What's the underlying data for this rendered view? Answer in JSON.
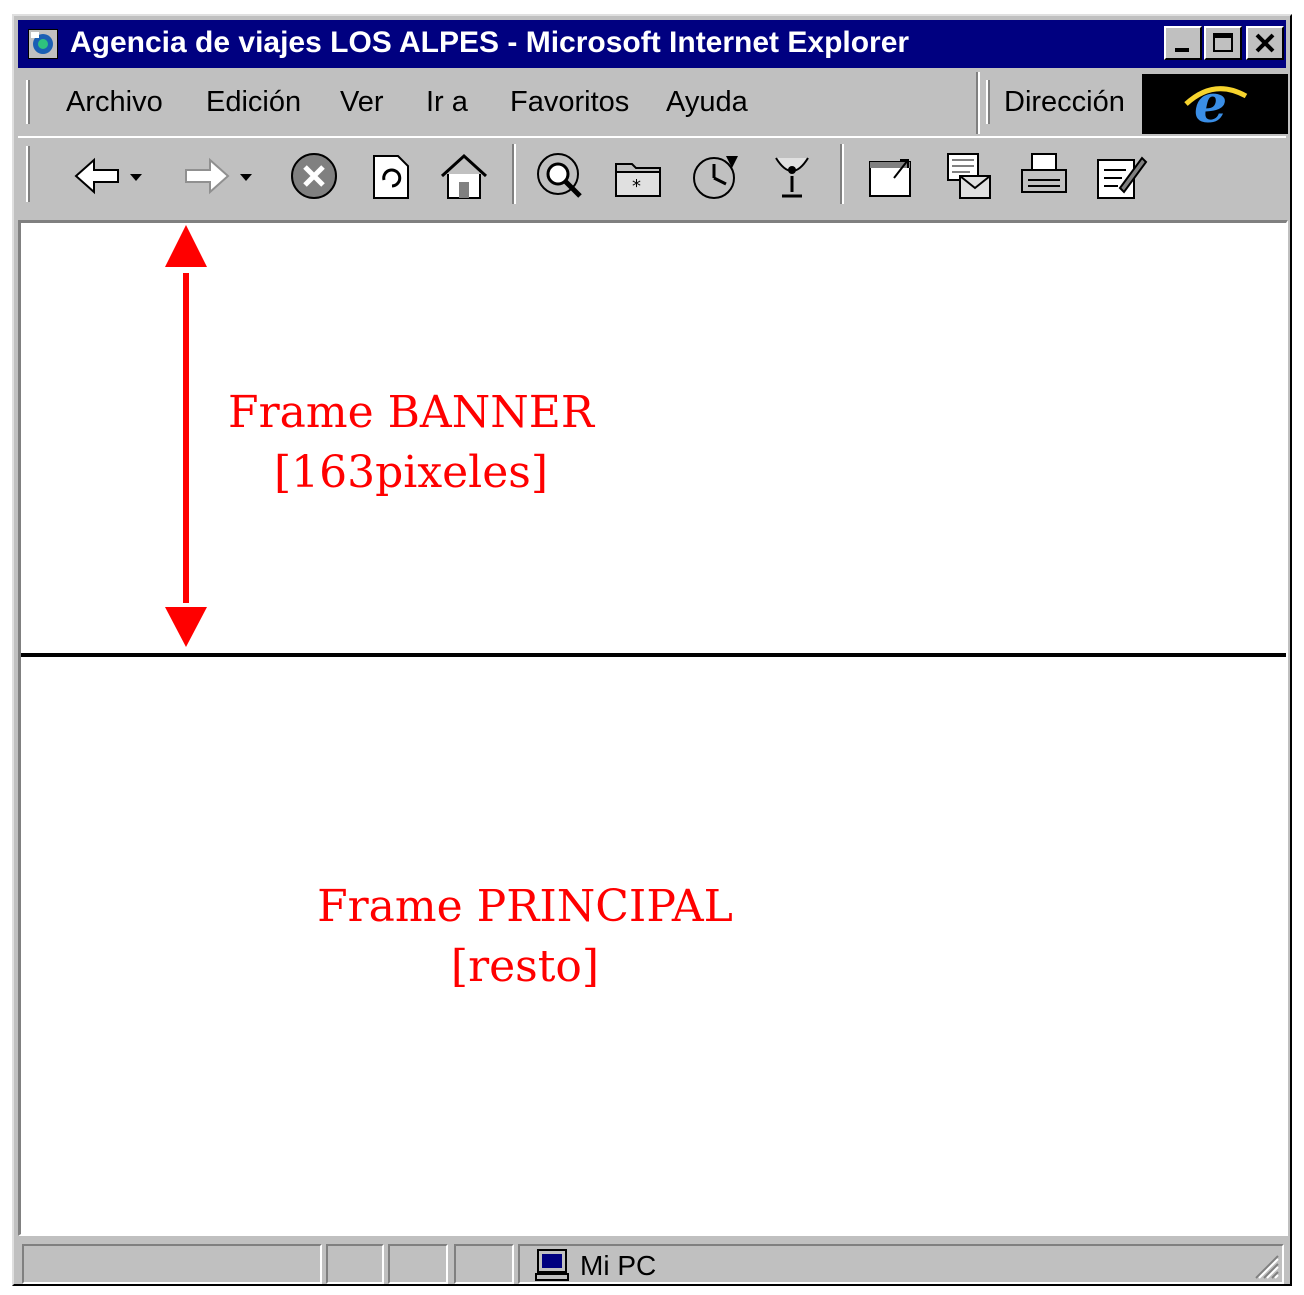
{
  "window": {
    "title": "Agencia de viajes LOS ALPES - Microsoft Internet Explorer"
  },
  "menu": {
    "items": [
      "Archivo",
      "Edición",
      "Ver",
      "Ir a",
      "Favoritos",
      "Ayuda"
    ],
    "address_label": "Dirección"
  },
  "toolbar": {
    "icons": [
      "back-icon",
      "forward-icon",
      "stop-icon",
      "refresh-icon",
      "home-icon",
      "search-icon",
      "favorites-icon",
      "history-icon",
      "channels-icon",
      "fullscreen-icon",
      "mail-icon",
      "print-icon",
      "edit-icon"
    ]
  },
  "frames": {
    "banner_line1": "Frame BANNER",
    "banner_line2": "[163pixeles]",
    "main_line1": "Frame PRINCIPAL",
    "main_line2": "[resto]"
  },
  "status": {
    "zone": "Mi PC"
  },
  "colors": {
    "titlebar": "#000080",
    "annotation": "#ff0000",
    "chrome": "#c0c0c0"
  }
}
